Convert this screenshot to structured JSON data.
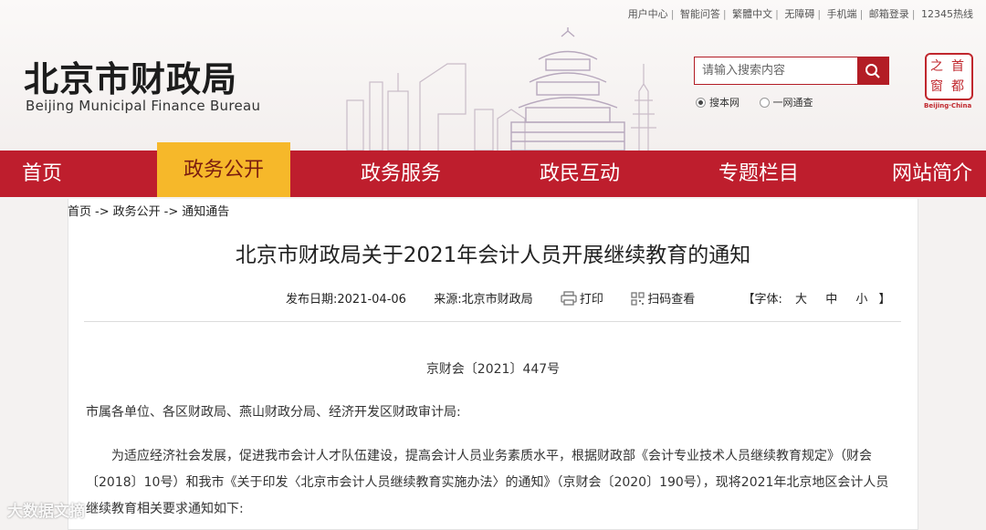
{
  "toplinks": [
    "用户中心",
    "智能问答",
    "繁體中文",
    "无障碍",
    "手机端",
    "邮箱登录",
    "12345热线"
  ],
  "logo": {
    "cn": "北京市财政局",
    "en": "Beijing Municipal Finance Bureau"
  },
  "search": {
    "placeholder": "请输入搜索内容",
    "scope_options": [
      "搜本网",
      "一网通查"
    ]
  },
  "seal": {
    "chars": [
      "首",
      "都",
      "之",
      "窗"
    ],
    "en": "Beijing·China"
  },
  "nav": [
    "首页",
    "政务公开",
    "政务服务",
    "政民互动",
    "专题栏目",
    "网站简介"
  ],
  "nav_active": "政务公开",
  "breadcrumb": [
    "首页",
    "->",
    "政务公开",
    "->",
    "通知通告"
  ],
  "article": {
    "title": "北京市财政局关于2021年会计人员开展继续教育的通知",
    "date_label": "发布日期:",
    "date": "2021-04-06",
    "source_label": "来源:",
    "source": "北京市财政局",
    "print": "打印",
    "qr": "扫码查看",
    "font_open": "【字体:",
    "font_sizes": [
      "大",
      "中",
      "小"
    ],
    "font_close": "】",
    "doc_number": "京财会〔2021〕447号",
    "para1": "市属各单位、各区财政局、燕山财政分局、经济开发区财政审计局:",
    "para2": "为适应经济社会发展，促进我市会计人才队伍建设，提高会计人员业务素质水平，根据财政部《会计专业技术人员继续教育规定》（财会〔2018〕10号）和我市《关于印发〈北京市会计人员继续教育实施办法〉的通知》（京财会〔2020〕190号），现将2021年北京地区会计人员继续教育相关要求通知如下:"
  },
  "watermark": "大数据文摘"
}
